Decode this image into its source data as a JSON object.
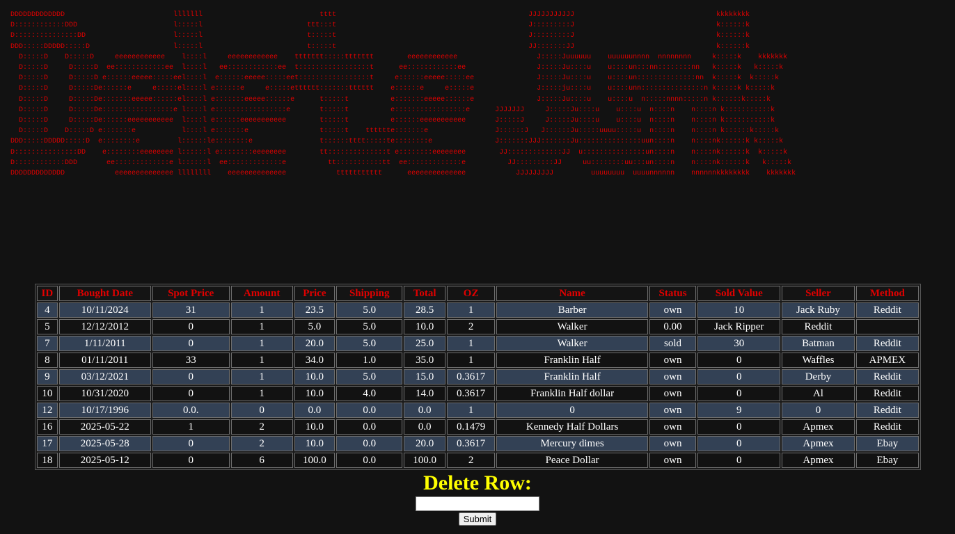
{
  "banner": {
    "ascii_art": "DDDDDDDDDDDDD                          lllllll                            tttt                                              JJJJJJJJJJJ                                  kkkkkkkk\nD::::::::::::DDD                       l:::::l                         ttt:::t                                              J:::::::::J                                  k::::::k\nD:::::::::::::::DD                     l:::::l                         t:::::t                                              J:::::::::J                                  k::::::k\nDDD:::::DDDDD:::::D                    l:::::l                         t:::::t                                              JJ:::::::JJ                                  k::::::k\n  D:::::D    D:::::D     eeeeeeeeeeee    l::::l     eeeeeeeeeeee    ttttttt:::::ttttttt        eeeeeeeeeeee                   J:::::Juuuuuu    uuuuuunnnn  nnnnnnnn     k:::::k    kkkkkkk\n  D:::::D     D:::::D  ee::::::::::::ee  l::::l   ee::::::::::::ee  t:::::::::::::::::t      ee::::::::::::ee                 J:::::Ju::::u    u::::un:::nn::::::::nn   k:::::k   k:::::k\n  D:::::D     D:::::D e::::::eeeee:::::eel::::l  e::::::eeeee:::::eet:::::::::::::::::t     e::::::eeeee:::::ee               J:::::Ju::::u    u::::un::::::::::::::nn  k:::::k  k:::::k\n  D:::::D     D:::::De::::::e     e:::::el::::l e::::::e     e:::::etttttt:::::::tttttt    e::::::e     e:::::e               J:::::ju::::u    u::::unn:::::::::::::::n k:::::k k:::::k\n  D:::::D     D:::::De:::::::eeeee::::::el::::l e:::::::eeeee::::::e      t:::::t          e:::::::eeeee::::::e               J:::::Ju::::u    u::::u  n:::::nnnn:::::n k::::::k:::::k\n  D:::::D     D:::::De:::::::::::::::::e l::::l e:::::::::::::::::e       t:::::t          e:::::::::::::::::e      JJJJJJJ     J:::::Ju::::u    u::::u  n::::n    n::::n k:::::::::::k\n  D:::::D     D:::::De::::::eeeeeeeeeee  l::::l e::::::eeeeeeeeeee        t:::::t          e::::::eeeeeeeeeee       J:::::J     J:::::Ju::::u    u::::u  n::::n    n::::n k:::::::::::k\n  D:::::D    D:::::D e:::::::e           l::::l e:::::::e                 t:::::t    tttttte:::::::e                J::::::J   J::::::Ju:::::uuuu:::::u  n::::n    n::::n k::::::k:::::k\nDDD:::::DDDDD:::::D  e::::::::e         l::::::le::::::::e                t::::::tttt:::::te::::::::e               J:::::::JJJ:::::::Ju:::::::::::::::uun::::n    n::::nk::::::k k:::::k\nD:::::::::::::::DD    e::::::::eeeeeeee l::::::l e::::::::eeeeeeee        tt::::::::::::::t e::::::::eeeeeeee        JJ:::::::::::::JJ  u:::::::::::::::un::::n    n::::nk::::::k  k:::::k\nD::::::::::::DDD       ee:::::::::::::e l::::::l  ee:::::::::::::e          tt:::::::::::tt  ee:::::::::::::e          JJ:::::::::JJ     uu::::::::uu:::un::::n    n::::nk::::::k   k:::::k\nDDDDDDDDDDDDD            eeeeeeeeeeeeee llllllll    eeeeeeeeeeeeee            ttttttttttt      eeeeeeeeeeeeee            JJJJJJJJJ         uuuuuuuu  uuuunnnnnn    nnnnnnkkkkkkkk    kkkkkkk"
  },
  "table": {
    "headers": [
      "ID",
      "Bought Date",
      "Spot Price",
      "Amount",
      "Price",
      "Shipping",
      "Total",
      "OZ",
      "Name",
      "Status",
      "Sold Value",
      "Seller",
      "Method"
    ],
    "rows": [
      [
        "4",
        "10/11/2024",
        "31",
        "1",
        "23.5",
        "5.0",
        "28.5",
        "1",
        "Barber",
        "own",
        "10",
        "Jack Ruby",
        "Reddit"
      ],
      [
        "5",
        "12/12/2012",
        "0",
        "1",
        "5.0",
        "5.0",
        "10.0",
        "2",
        "Walker",
        "0.00",
        "Jack Ripper",
        "Reddit",
        ""
      ],
      [
        "7",
        "1/11/2011",
        "0",
        "1",
        "20.0",
        "5.0",
        "25.0",
        "1",
        "Walker",
        "sold",
        "30",
        "Batman",
        "Reddit"
      ],
      [
        "8",
        "01/11/2011",
        "33",
        "1",
        "34.0",
        "1.0",
        "35.0",
        "1",
        "Franklin Half",
        "own",
        "0",
        "Waffles",
        "APMEX"
      ],
      [
        "9",
        "03/12/2021",
        "0",
        "1",
        "10.0",
        "5.0",
        "15.0",
        "0.3617",
        "Franklin Half",
        "own",
        "0",
        "Derby",
        "Reddit"
      ],
      [
        "10",
        "10/31/2020",
        "0",
        "1",
        "10.0",
        "4.0",
        "14.0",
        "0.3617",
        "Franklin Half dollar",
        "own",
        "0",
        "Al",
        "Reddit"
      ],
      [
        "12",
        "10/17/1996",
        "0.0.",
        "0",
        "0.0",
        "0.0",
        "0.0",
        "1",
        "0",
        "own",
        "9",
        "0",
        "Reddit"
      ],
      [
        "16",
        "2025-05-22",
        "1",
        "2",
        "10.0",
        "0.0",
        "0.0",
        "0.1479",
        "Kennedy Half Dollars",
        "own",
        "0",
        "Apmex",
        "Reddit"
      ],
      [
        "17",
        "2025-05-28",
        "0",
        "2",
        "10.0",
        "0.0",
        "20.0",
        "0.3617",
        "Mercury dimes",
        "own",
        "0",
        "Apmex",
        "Ebay"
      ],
      [
        "18",
        "2025-05-12",
        "0",
        "6",
        "100.0",
        "0.0",
        "100.0",
        "2",
        "Peace Dollar",
        "own",
        "0",
        "Apmex",
        "Ebay"
      ]
    ]
  },
  "delete_form": {
    "title": "Delete Row:",
    "input_value": "",
    "submit_label": "Submit"
  },
  "colors": {
    "background": "#121212",
    "header_text": "#e00000",
    "banner_text": "#e00000",
    "row_alt": "#334155",
    "title_yellow": "#ffff00"
  }
}
